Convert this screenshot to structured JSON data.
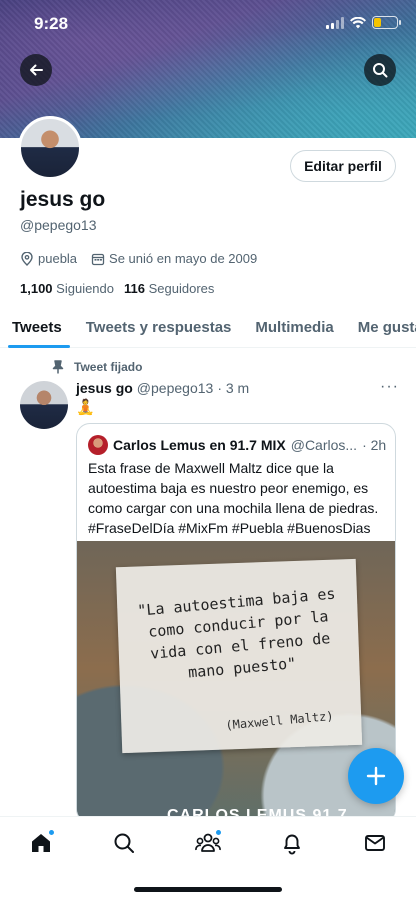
{
  "status_bar": {
    "time": "9:28"
  },
  "profile": {
    "name": "jesus go",
    "handle": "@pepego13",
    "edit_label": "Editar perfil",
    "location": "puebla",
    "joined": "Se unió en mayo de 2009",
    "following_count": "1,100",
    "following_label": "Siguiendo",
    "followers_count": "116",
    "followers_label": "Seguidores"
  },
  "tabs": [
    {
      "label": "Tweets",
      "active": true
    },
    {
      "label": "Tweets y respuestas",
      "active": false
    },
    {
      "label": "Multimedia",
      "active": false
    },
    {
      "label": "Me gusta",
      "active": false
    }
  ],
  "pinned_tweet": {
    "pinned_label": "Tweet fijado",
    "author_name": "jesus go",
    "author_handle": "@pepego13",
    "time": "· 3 m",
    "more": "···",
    "emoji": "🧘",
    "quoted": {
      "author_name": "Carlos Lemus en 91.7 MIX",
      "author_handle": "@Carlos...",
      "time": "· 2h",
      "text": "Esta frase de Maxwell Maltz dice que la autoestima baja es nuestro peor enemigo, es como cargar con una mochila llena de piedras. #FraseDelDía #MixFm #Puebla #BuenosDias",
      "image_quote": "\"La autoestima baja es como conducir por la vida con el freno de mano puesto\"",
      "image_author": "(Maxwell Maltz)",
      "image_footer": "CARLOS LEMUS 91.7"
    }
  },
  "icons": {
    "back": "back-arrow-icon",
    "search": "search-icon",
    "location": "location-pin-icon",
    "calendar": "calendar-icon",
    "pin": "pin-icon",
    "compose": "plus-icon",
    "nav": [
      "home-icon",
      "search-icon",
      "communities-icon",
      "notifications-icon",
      "messages-icon"
    ]
  },
  "colors": {
    "accent": "#1d9bf0",
    "text": "#0f1419",
    "secondary": "#536471"
  }
}
